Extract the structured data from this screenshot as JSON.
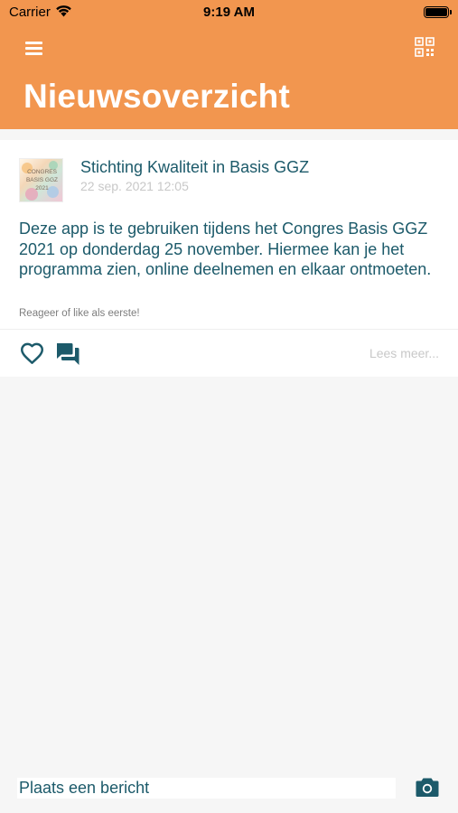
{
  "statusbar": {
    "carrier": "Carrier",
    "time": "9:19 AM"
  },
  "header": {
    "title": "Nieuwsoverzicht",
    "menu_icon": "hamburger-menu-icon",
    "qr_icon": "qr-code-icon",
    "background_color": "#f2964f"
  },
  "post": {
    "author": "Stichting Kwaliteit in Basis GGZ",
    "date": "22 sep. 2021 12:05",
    "avatar_text": [
      "CONGRES",
      "BASIS GGZ",
      "2021"
    ],
    "text": "Deze app is te gebruiken tijdens het Congres Basis GGZ 2021 op donderdag 25 november. Hiermee kan je het programma zien, online deelnemen en elkaar ontmoeten.",
    "reaction_hint": "Reageer of like als eerste!",
    "like_icon": "heart-outline-icon",
    "comment_icon": "comments-icon",
    "read_more": "Lees meer..."
  },
  "composer": {
    "placeholder": "Plaats een bericht",
    "camera_icon": "camera-icon"
  },
  "colors": {
    "accent": "#f2964f",
    "text": "#1c5a6a",
    "muted": "#c8c8c8"
  }
}
